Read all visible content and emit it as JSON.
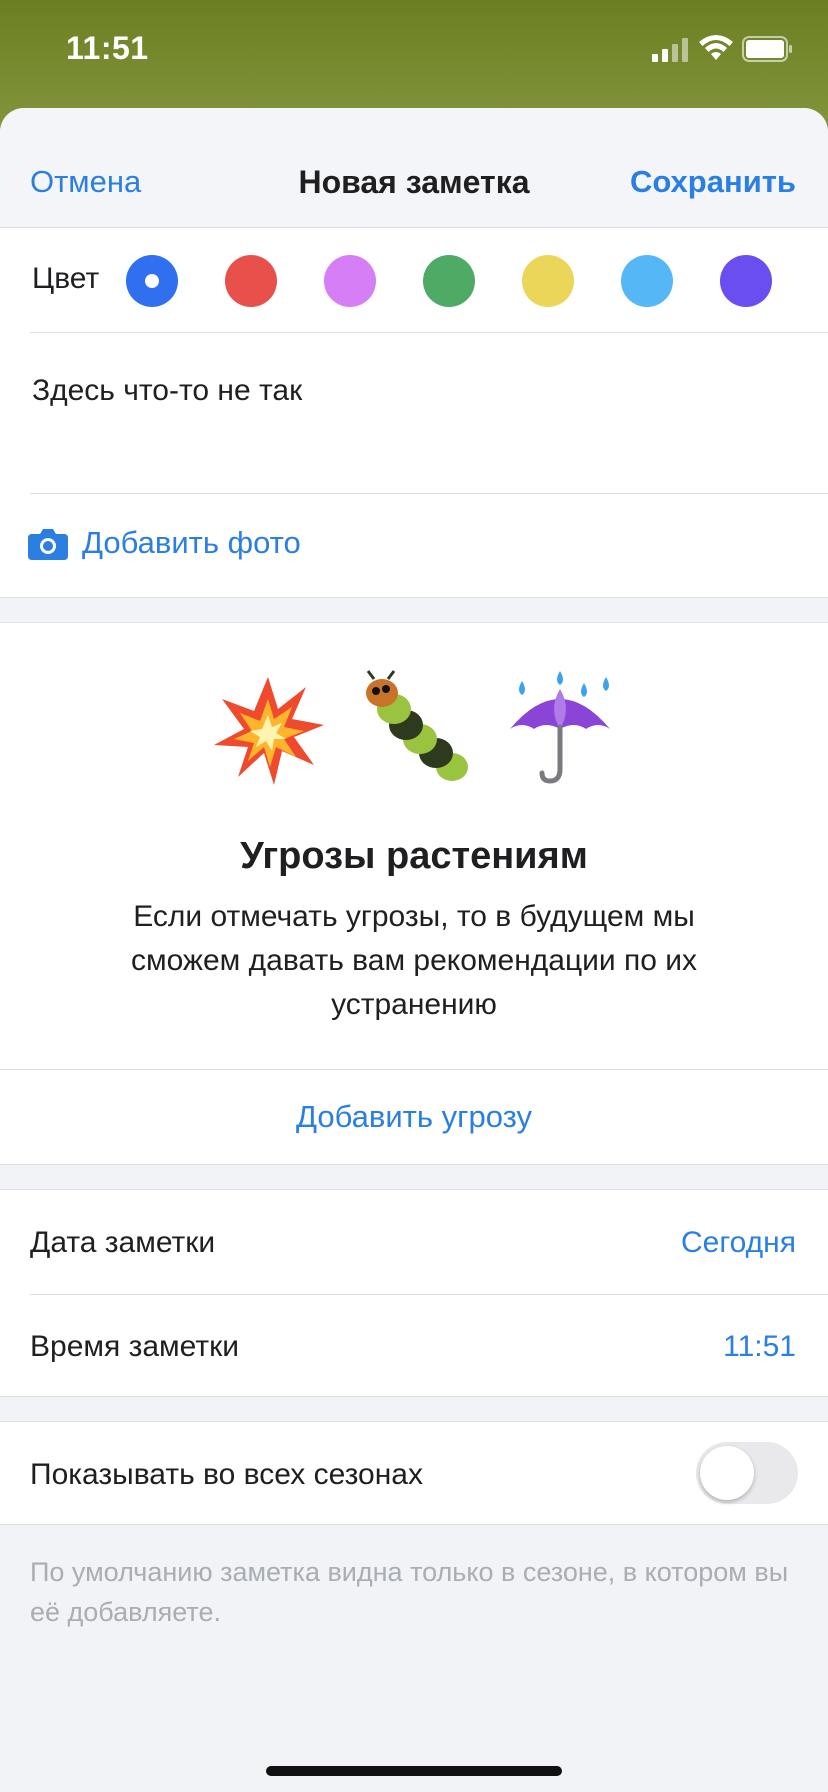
{
  "status_bar": {
    "time": "11:51",
    "icons": [
      "cellular-signal-icon",
      "wifi-icon",
      "battery-icon"
    ]
  },
  "navbar": {
    "cancel": "Отмена",
    "title": "Новая заметка",
    "save": "Сохранить"
  },
  "color_picker": {
    "label": "Цвет",
    "selected_index": 0,
    "colors": [
      "#2f6ff0",
      "#e8504b",
      "#d67ef5",
      "#4faa66",
      "#ebd65a",
      "#56b7f7",
      "#6b4ef0"
    ]
  },
  "note": {
    "text": "Здесь что-то не так"
  },
  "photo": {
    "label": "Добавить фото",
    "icon": "camera-icon"
  },
  "threats": {
    "emojis": [
      "explosion-icon",
      "caterpillar-icon",
      "umbrella-rain-icon"
    ],
    "title": "Угрозы растениям",
    "description": "Если отмечать угрозы, то в будущем мы сможем давать вам рекомендации по их устранению",
    "add_label": "Добавить угрозу"
  },
  "details": {
    "date_label": "Дата заметки",
    "date_value": "Сегодня",
    "time_label": "Время заметки",
    "time_value": "11:51"
  },
  "seasons": {
    "label": "Показывать во всех сезонах",
    "enabled": false,
    "footnote": "По умолчанию заметка видна только в сезоне, в котором вы её добавляете."
  }
}
